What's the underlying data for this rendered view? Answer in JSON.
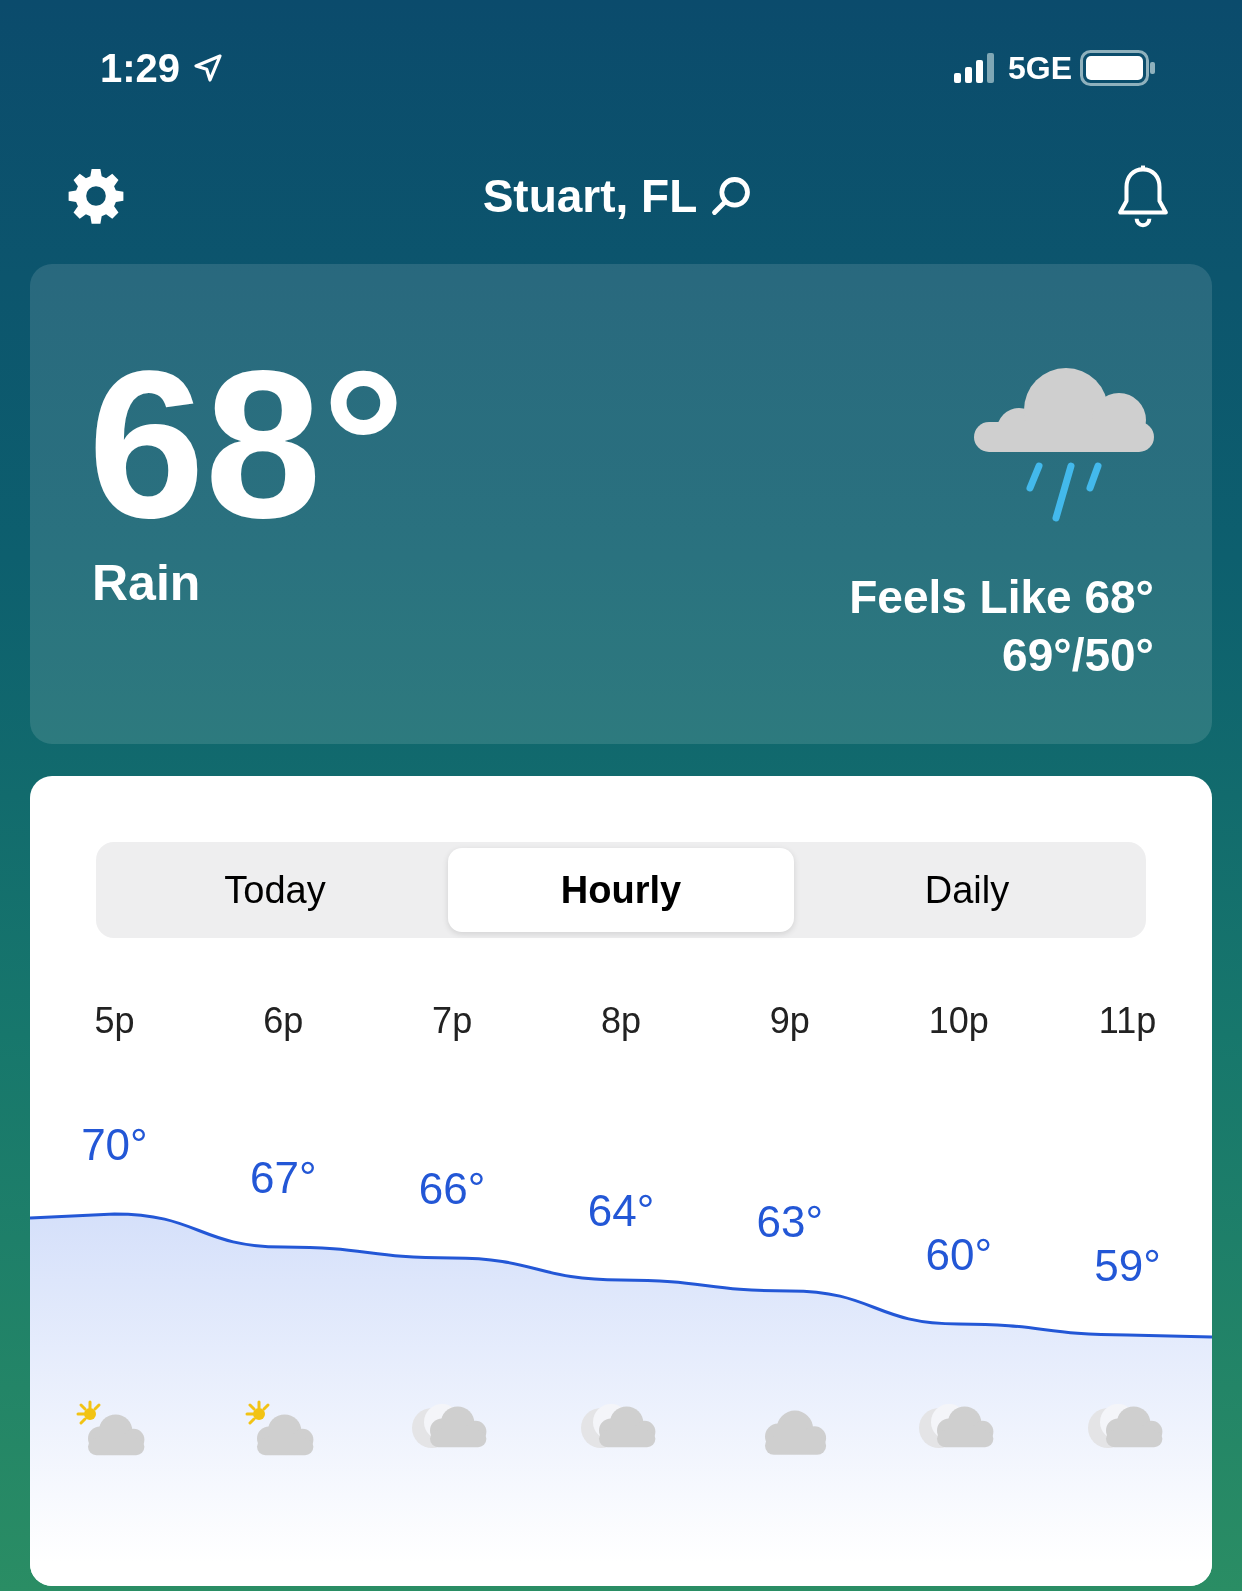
{
  "status_bar": {
    "time": "1:29",
    "network": "5GE"
  },
  "header": {
    "location": "Stuart, FL"
  },
  "current": {
    "temperature": "68°",
    "condition": "Rain",
    "feels_like": "Feels Like 68°",
    "high_low": "69°/50°"
  },
  "tabs": [
    {
      "label": "Today",
      "selected": false
    },
    {
      "label": "Hourly",
      "selected": true
    },
    {
      "label": "Daily",
      "selected": false
    }
  ],
  "hourly": [
    {
      "time": "5p",
      "temp": "70°",
      "kind": "sun"
    },
    {
      "time": "6p",
      "temp": "67°",
      "kind": "sun"
    },
    {
      "time": "7p",
      "temp": "66°",
      "kind": "moon"
    },
    {
      "time": "8p",
      "temp": "64°",
      "kind": "moon"
    },
    {
      "time": "9p",
      "temp": "63°",
      "kind": "cloud"
    },
    {
      "time": "10p",
      "temp": "60°",
      "kind": "moon"
    },
    {
      "time": "11p",
      "temp": "59°",
      "kind": "moon"
    }
  ]
}
